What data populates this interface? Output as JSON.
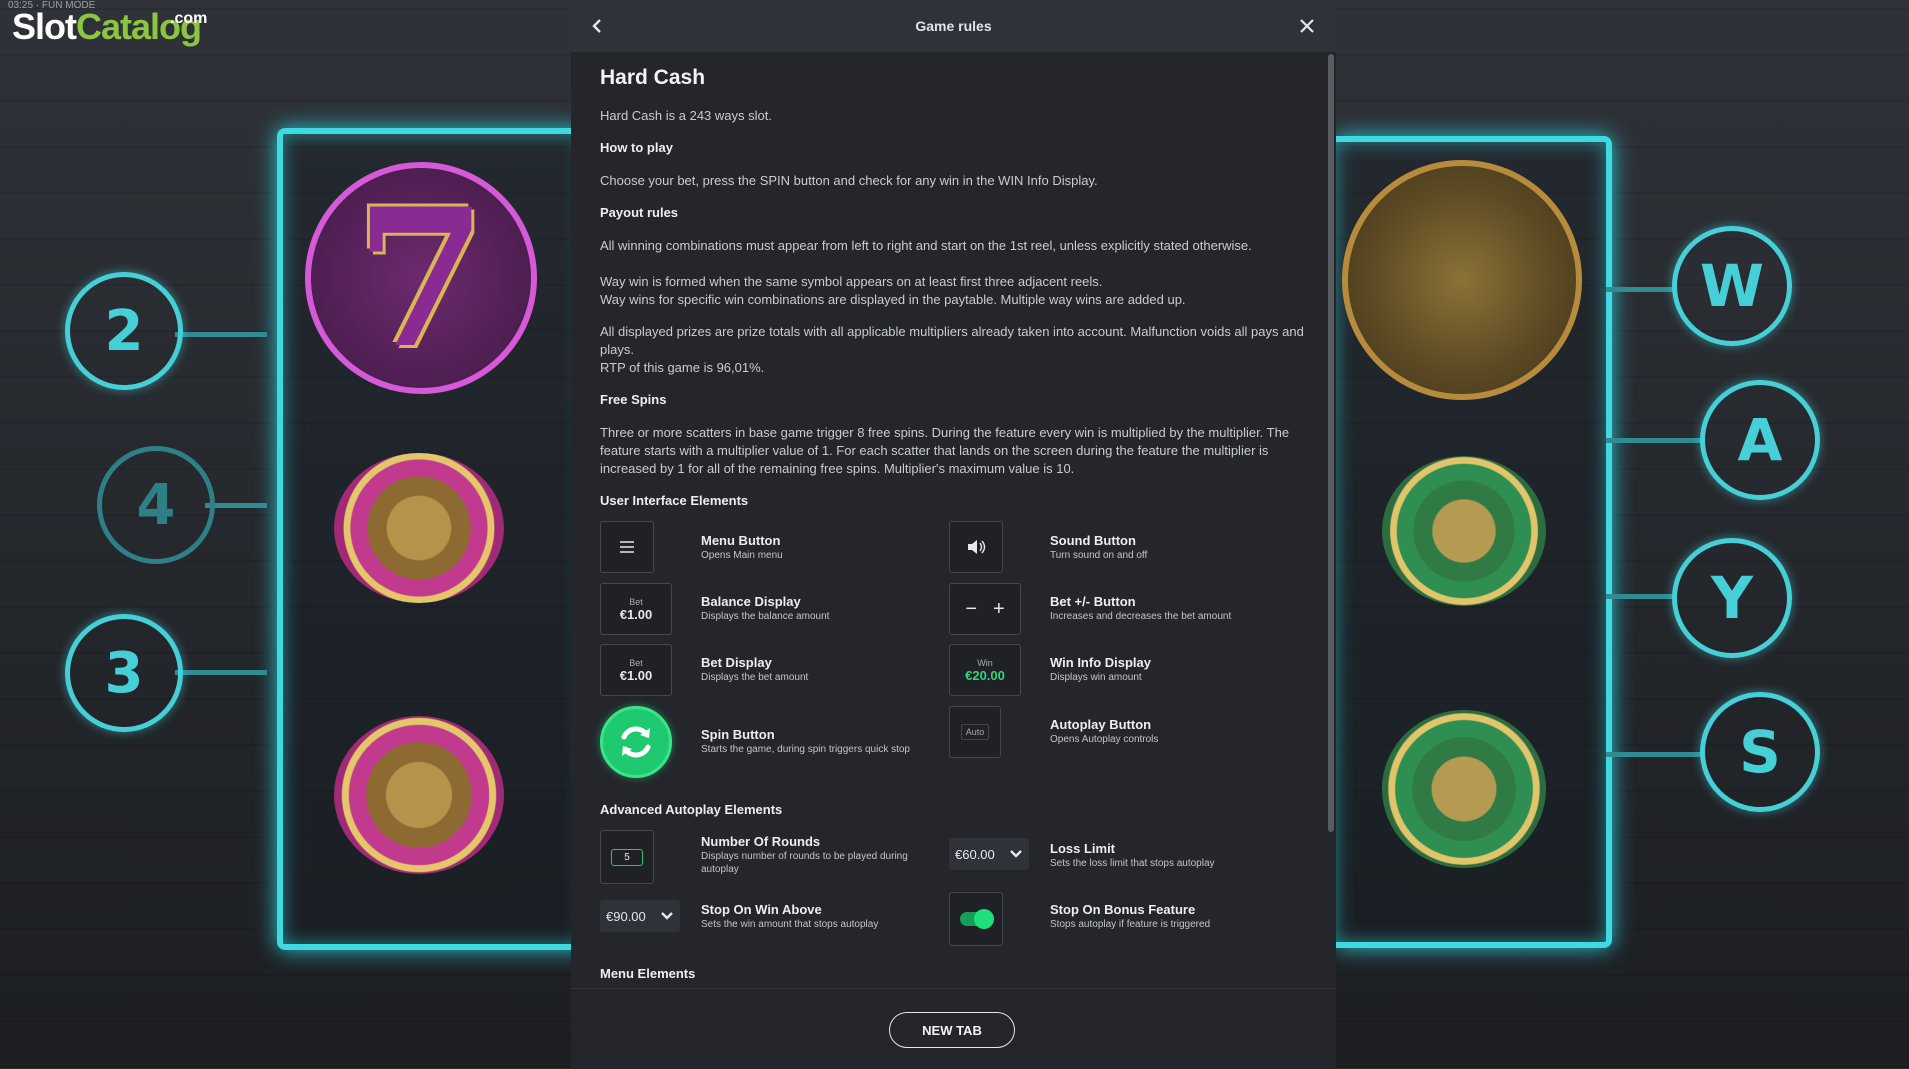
{
  "brand": {
    "fun_mode": "03:25 · FUN MODE",
    "slot": "Slot",
    "catalog": "Catalog",
    "com": ".com"
  },
  "background": {
    "left_rings": [
      "2",
      "4",
      "3"
    ],
    "right_rings": [
      "W",
      "A",
      "Y",
      "S"
    ],
    "seven_symbol": "7"
  },
  "modal": {
    "title": "Game rules",
    "back_icon": "chevron-left-icon",
    "close_icon": "close-icon",
    "game_title": "Hard Cash",
    "intro": "Hard Cash is a 243 ways slot.",
    "how_to_play_heading": "How to play",
    "how_to_play_text": "Choose your bet, press the SPIN button and check for any win in the WIN Info Display.",
    "payout_heading": "Payout rules",
    "payout_p1": "All winning combinations must appear from left to right and start on the 1st reel, unless explicitly stated otherwise.",
    "payout_p2": "Way win is formed when the same symbol appears on at least first three adjacent reels.",
    "payout_p3": "Way wins for specific win combinations are displayed in the paytable. Multiple way wins are added up.",
    "payout_p4": "All displayed prizes are prize totals with all applicable multipliers already taken into account. Malfunction voids all pays and plays.",
    "payout_p5": "RTP of this game is 96,01%.",
    "free_spins_heading": "Free Spins",
    "free_spins_text": "Three or more scatters in base game trigger 8 free spins. During the feature every win is multiplied by the multiplier. The feature starts with a multiplier value of 1. For each scatter that lands on the screen during the feature the multiplier is increased by 1 for all of the remaining free spins. Multiplier's maximum value is 10.",
    "ui_heading": "User Interface Elements",
    "ui_elements": {
      "menu": {
        "title": "Menu Button",
        "desc": "Opens Main menu",
        "icon": "menu-icon"
      },
      "sound": {
        "title": "Sound Button",
        "desc": "Turn sound on and off",
        "icon": "speaker-icon"
      },
      "balance": {
        "title": "Balance Display",
        "desc": "Displays the balance amount",
        "label": "Bet",
        "value": "€1.00"
      },
      "betpm": {
        "title": "Bet +/- Button",
        "desc": "Increases and decreases the bet amount",
        "minus": "−",
        "plus": "+"
      },
      "bet": {
        "title": "Bet Display",
        "desc": "Displays the bet amount",
        "label": "Bet",
        "value": "€1.00"
      },
      "win": {
        "title": "Win Info Display",
        "desc": "Displays win amount",
        "label": "Win",
        "value": "€20.00"
      },
      "spin": {
        "title": "Spin Button",
        "desc": "Starts the game, during spin triggers quick stop",
        "icon": "refresh-icon"
      },
      "autoplay": {
        "title": "Autoplay Button",
        "desc": "Opens Autoplay controls",
        "label": "Auto"
      }
    },
    "adv_heading": "Advanced Autoplay Elements",
    "adv_elements": {
      "rounds": {
        "title": "Number Of Rounds",
        "desc": "Displays number of rounds to be played during autoplay",
        "value": "5"
      },
      "loss": {
        "title": "Loss Limit",
        "desc": "Sets the loss limit that stops autoplay",
        "value": "€60.00"
      },
      "stopwin": {
        "title": "Stop On Win Above",
        "desc": "Sets the win amount that stops autoplay",
        "value": "€90.00"
      },
      "stopbonus": {
        "title": "Stop On Bonus Feature",
        "desc": "Stops autoplay if feature is triggered",
        "toggle_on": true
      }
    },
    "menu_heading": "Menu Elements",
    "new_tab": "NEW TAB"
  },
  "colors": {
    "accent_green": "#1fc96f",
    "neon_cyan": "#3fd9e2",
    "panel": "#24262c",
    "header": "#303239"
  }
}
